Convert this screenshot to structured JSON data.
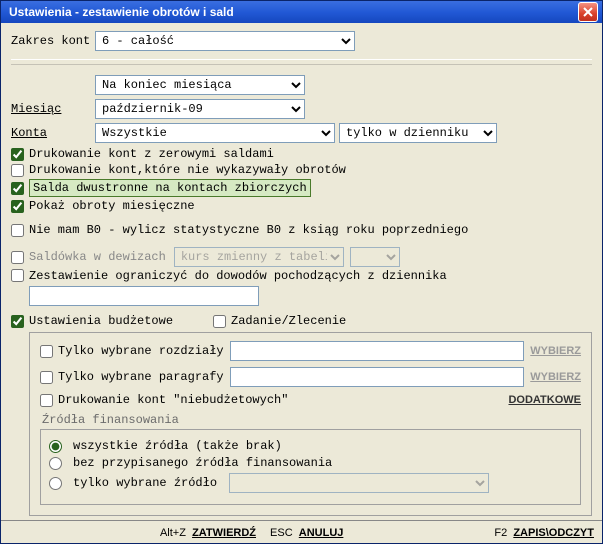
{
  "title": "Ustawienia - zestawienie obrotów i sald",
  "labels": {
    "zakres_kont": "Zakres kont",
    "miesiac": "Miesiąc",
    "konta": "Konta"
  },
  "zakres_kont": {
    "value": "6 - całość"
  },
  "czas": {
    "value": "Na koniec miesiąca"
  },
  "miesiac": {
    "value": "październik-09"
  },
  "konta": {
    "value": "Wszystkie"
  },
  "dziennik_filter": {
    "value": "tylko w dzienniku"
  },
  "checks": {
    "zerowe_salda": "Drukowanie kont z zerowymi saldami",
    "bez_obrotow": "Drukowanie kont,które nie wykazywały obrotów",
    "salda_dwustr": "Salda dwustronne na kontach zbiorczych",
    "obroty_mies": "Pokaż obroty miesięczne",
    "nie_mam_b0": "Nie mam B0 - wylicz statystyczne B0 z ksiąg roku poprzedniego",
    "saldowka_dew": "Saldówka w dewizach",
    "kurs_placeholder": "kurs zmienny z tabeli",
    "zest_dziennik": "Zestawienie ograniczyć do dowodów pochodzących z dziennika",
    "ust_budzetowe": "Ustawienia budżetowe",
    "zadanie_zlecenie": "Zadanie/Zlecenie"
  },
  "budget": {
    "rozdzialy": "Tylko wybrane rozdziały",
    "paragrafy": "Tylko wybrane paragrafy",
    "niebudzetowe": "Drukowanie kont \"niebudżetowych\"",
    "wybierz": "WYBIERZ",
    "dodatkowe": "DODATKOWE",
    "zrodla_label": "Źródła finansowania",
    "r_wszystkie": "wszystkie źródła (także brak)",
    "r_bez_przyp": "bez przypisanego źródła finansowania",
    "r_tylko_wyb": "tylko wybrane źródło"
  },
  "footer": {
    "altz": "Alt+Z",
    "zatwierdz": "ZATWIERDŹ",
    "esc": "ESC",
    "anuluj": "ANULUJ",
    "f2": "F2",
    "zapisodczyt": "ZAPIS\\ODCZYT"
  }
}
